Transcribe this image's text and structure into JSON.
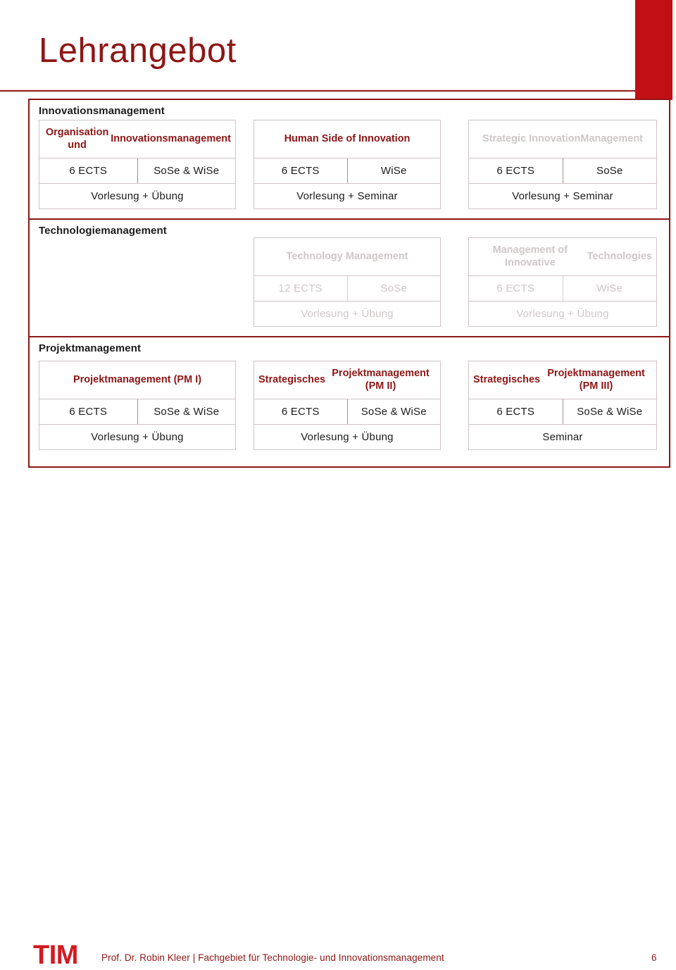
{
  "slide": {
    "title": "Lehrangebot",
    "page_number": "6"
  },
  "theme": {
    "accent_red": "#c10f13",
    "dark_red": "#8e1616",
    "logo_red": "#d41a22",
    "muted_grey": "#cfc7c8",
    "card_border": "#cfc3c4"
  },
  "footer": {
    "logo": "TIM",
    "text": "Prof. Dr. Robin Kleer | Fachgebiet für Technologie- und Innovationsmanagement"
  },
  "sections": [
    {
      "title": "Innovationsmanagement",
      "cards": [
        {
          "title": "Organisation und Innovationsmanagement",
          "title_line1": "Organisation und",
          "title_line2": "Innovationsmanagement",
          "ects": "6 ECTS",
          "term": "SoSe & WiSe",
          "format": "Vorlesung + Übung",
          "faded": false,
          "title_faded": false
        },
        {
          "title": "Human Side of Innovation",
          "title_line1": "Human Side of Innovation",
          "title_line2": "",
          "ects": "6 ECTS",
          "term": "WiSe",
          "format": "Vorlesung + Seminar",
          "faded": false,
          "title_faded": false
        },
        {
          "title": "Strategic Innovation Management",
          "title_line1": "Strategic Innovation",
          "title_line2": "Management",
          "ects": "6 ECTS",
          "term": "SoSe",
          "format": "Vorlesung + Seminar",
          "faded": false,
          "title_faded": true
        }
      ]
    },
    {
      "title": "Technologiemanagement",
      "cards": [
        {
          "title": "",
          "title_line1": "",
          "title_line2": "",
          "ects": "",
          "term": "",
          "format": "",
          "faded": true,
          "title_faded": true,
          "empty": true
        },
        {
          "title": "Technology Management",
          "title_line1": "Technology Management",
          "title_line2": "",
          "ects": "12 ECTS",
          "term": "SoSe",
          "format": "Vorlesung + Übung",
          "faded": true,
          "title_faded": true
        },
        {
          "title": "Management of Innovative Technologies",
          "title_line1": "Management of Innovative",
          "title_line2": "Technologies",
          "ects": "6 ECTS",
          "term": "WiSe",
          "format": "Vorlesung + Übung",
          "faded": true,
          "title_faded": true
        }
      ]
    },
    {
      "title": "Projektmanagement",
      "cards": [
        {
          "title": "Projektmanagement (PM I)",
          "title_line1": "Projektmanagement (PM I)",
          "title_line2": "",
          "ects": "6 ECTS",
          "term": "SoSe & WiSe",
          "format": "Vorlesung + Übung",
          "faded": false,
          "title_faded": false
        },
        {
          "title": "Strategisches Projektmanagement (PM II)",
          "title_line1": "Strategisches",
          "title_line2": "Projektmanagement (PM II)",
          "ects": "6 ECTS",
          "term": "SoSe & WiSe",
          "format": "Vorlesung + Übung",
          "faded": false,
          "title_faded": false
        },
        {
          "title": "Strategisches Projektmanagement (PM III)",
          "title_line1": "Strategisches",
          "title_line2": "Projektmanagement (PM III)",
          "ects": "6 ECTS",
          "term": "SoSe & WiSe",
          "format": "Seminar",
          "faded": false,
          "title_faded": false
        }
      ]
    }
  ]
}
